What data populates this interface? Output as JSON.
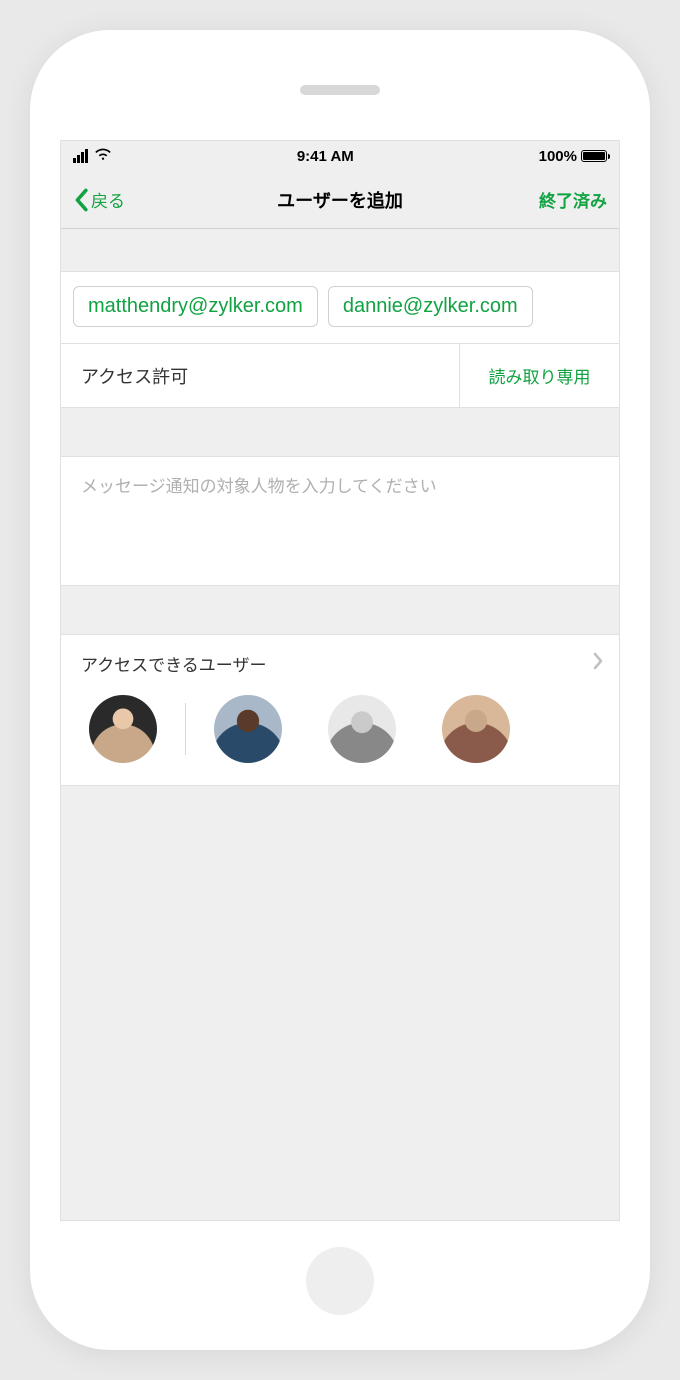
{
  "status_bar": {
    "time": "9:41 AM",
    "battery_pct": "100%"
  },
  "nav": {
    "back_label": "戻る",
    "title": "ユーザーを追加",
    "done_label": "終了済み"
  },
  "emails": [
    "matthendry@zylker.com",
    "dannie@zylker.com"
  ],
  "permission": {
    "label": "アクセス許可",
    "value": "読み取り専用"
  },
  "message": {
    "placeholder": "メッセージ通知の対象人物を入力してください"
  },
  "access": {
    "label": "アクセスできるユーザー",
    "avatars": [
      {
        "name": "user-1"
      },
      {
        "name": "user-2"
      },
      {
        "name": "user-3"
      },
      {
        "name": "user-4"
      }
    ]
  },
  "colors": {
    "accent": "#11a242"
  }
}
